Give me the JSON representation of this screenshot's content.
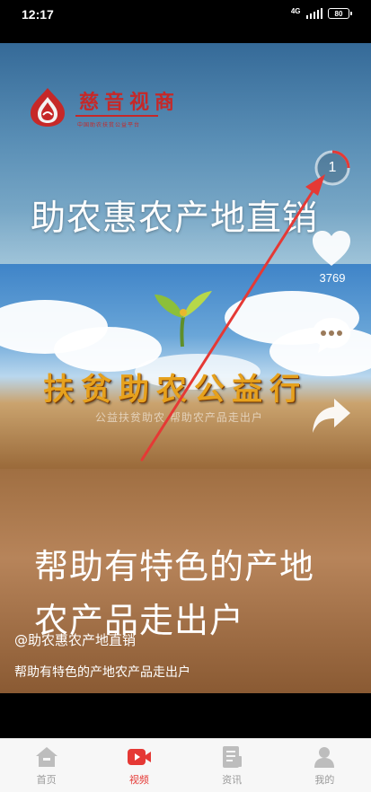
{
  "status_bar": {
    "time": "12:17",
    "network": "4G",
    "battery": "80"
  },
  "video": {
    "logo_name": "慈音视商",
    "logo_tagline": "中国助农扶贫公益平台",
    "headline": "助农惠农产地直销",
    "mid_title": "扶贫助农公益行",
    "mid_subtitle": "公益扶贫助农 帮助农产品走出户",
    "bottom_line1": "帮助有特色的产地",
    "bottom_line2": "农产品走出户"
  },
  "actions": {
    "timer_count": "1",
    "like_count": "3769"
  },
  "post": {
    "author": "@助农惠农产地直销",
    "caption": "帮助有特色的产地农产品走出户"
  },
  "nav": {
    "items": [
      {
        "label": "首页",
        "icon": "home-icon"
      },
      {
        "label": "视频",
        "icon": "video-icon"
      },
      {
        "label": "资讯",
        "icon": "news-icon"
      },
      {
        "label": "我的",
        "icon": "profile-icon"
      }
    ],
    "active": "视频"
  },
  "colors": {
    "accent": "#e53935",
    "nav_inactive": "#bdbdbd",
    "annotation_arrow": "#e53935"
  }
}
